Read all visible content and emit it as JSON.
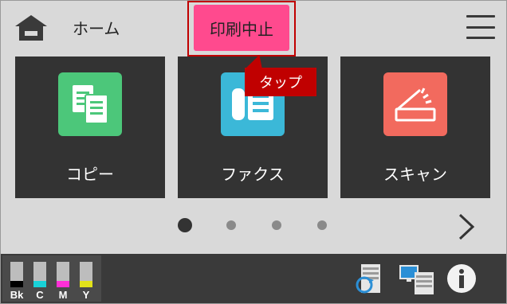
{
  "header": {
    "home_label": "ホーム",
    "stop_print_label": "印刷中止",
    "callout_label": "タップ"
  },
  "tiles": [
    {
      "label": "コピー",
      "icon": "copy-icon",
      "color": "#4cc77a"
    },
    {
      "label": "ファクス",
      "icon": "fax-icon",
      "color": "#3bb8d8"
    },
    {
      "label": "スキャン",
      "icon": "scan-icon",
      "color": "#f26a5e"
    }
  ],
  "pager": {
    "pages": 4,
    "current": 1
  },
  "ink": [
    {
      "label": "Bk",
      "color": "#000000"
    },
    {
      "label": "C",
      "color": "#18d2d8"
    },
    {
      "label": "M",
      "color": "#ff2fd6"
    },
    {
      "label": "Y",
      "color": "#e2e21a"
    }
  ],
  "status_icons": [
    "wireless-direct-icon",
    "network-printer-icon",
    "info-icon"
  ],
  "colors": {
    "background": "#d9d9d9",
    "tile_bg": "#333333",
    "stop_button": "#ff4a8e",
    "callout": "#c00000",
    "statusbar": "#3a3a3a"
  }
}
